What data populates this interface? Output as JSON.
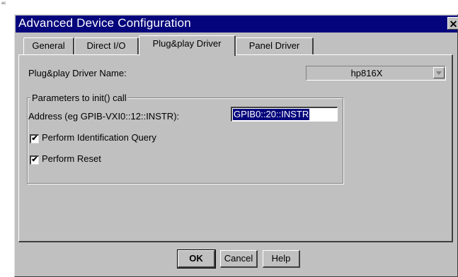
{
  "corner_mark": "ac",
  "window": {
    "title": "Advanced Device Configuration",
    "close_glyph": "✕"
  },
  "tabs": [
    {
      "label": "General"
    },
    {
      "label": "Direct I/O"
    },
    {
      "label": "Plug&play Driver",
      "active": true
    },
    {
      "label": "Panel Driver"
    }
  ],
  "driver": {
    "label": "Plug&play Driver Name:",
    "selected_value": "hp816X"
  },
  "init_params": {
    "legend": "Parameters to init() call",
    "address_label": "Address (eg GPIB-VXI0::12::INSTR):",
    "address_value": "GPIB0::20::INSTR",
    "identification_label": "Perform Identification Query",
    "identification_checked": true,
    "reset_label": "Perform Reset",
    "reset_checked": true,
    "check_glyph": "✔"
  },
  "buttons": {
    "ok": "OK",
    "cancel": "Cancel",
    "help": "Help"
  },
  "colors": {
    "titlebar": "#04047c",
    "face": "#c0c0c0",
    "selection": "#04047c"
  },
  "icons": {
    "close": "close-icon",
    "dropdown": "chevron-down-icon",
    "check": "checkmark-icon"
  }
}
